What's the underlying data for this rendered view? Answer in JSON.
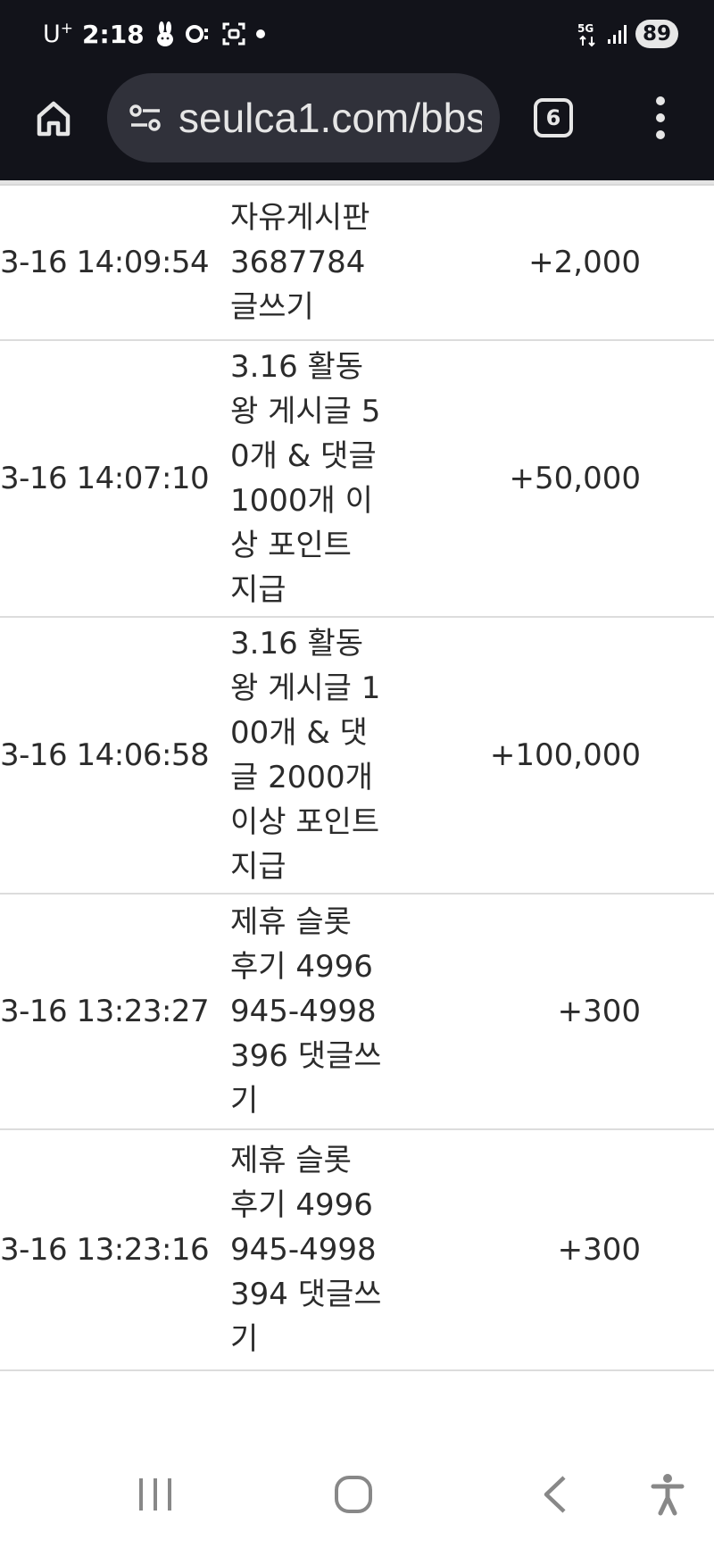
{
  "status_bar": {
    "carrier": "U",
    "carrier_sup": "+",
    "time": "2:18",
    "network": "5G",
    "battery": "89"
  },
  "browser": {
    "url": "seulca1.com/bbs",
    "tab_count": "6"
  },
  "rows": [
    {
      "date": "3-16 14:09:54",
      "desc": "자유게시판 3687784 글쓰기",
      "amount": "+2,000",
      "height": 174
    },
    {
      "date": "3-16 14:07:10",
      "desc": "3.16 활동왕 게시글 50개 & 댓글 1000개 이상 포인트 지급",
      "amount": "+50,000",
      "height": 310
    },
    {
      "date": "3-16 14:06:58",
      "desc": "3.16 활동왕 게시글 100개 & 댓글 2000개 이상 포인트 지급",
      "amount": "+100,000",
      "height": 310
    },
    {
      "date": "3-16 13:23:27",
      "desc": "제휴 슬롯 후기 4996945-4998396 댓글쓰기",
      "amount": "+300",
      "height": 264
    },
    {
      "date": "3-16 13:23:16",
      "desc": "제휴 슬롯 후기 4996945-4998394 댓글쓰기",
      "amount": "+300",
      "height": 270
    }
  ],
  "colors": {
    "chrome_bg": "#12131a",
    "url_bar_bg": "#30313a",
    "row_divider": "#dcdcdc",
    "text": "#2b2b2b"
  },
  "icons": {
    "home": "home-icon",
    "site_info": "tune-icon",
    "menu": "more-vertical-icon",
    "recents": "recent-apps-icon",
    "nav_home": "home-circle-icon",
    "back": "back-icon",
    "accessibility": "accessibility-icon"
  }
}
